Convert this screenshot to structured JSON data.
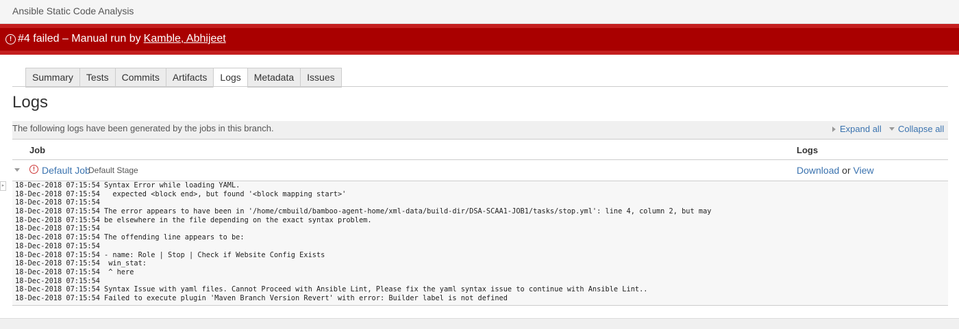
{
  "plan": {
    "name": "Ansible Static Code Analysis"
  },
  "banner": {
    "icon": "alert-circle-icon",
    "status_text": "#4 failed – Manual run by",
    "user": "Kamble, Abhijeet",
    "color": "#a90000"
  },
  "tabs": [
    {
      "label": "Summary",
      "active": false
    },
    {
      "label": "Tests",
      "active": false
    },
    {
      "label": "Commits",
      "active": false
    },
    {
      "label": "Artifacts",
      "active": false
    },
    {
      "label": "Logs",
      "active": true
    },
    {
      "label": "Metadata",
      "active": false
    },
    {
      "label": "Issues",
      "active": false
    }
  ],
  "page": {
    "title": "Logs",
    "intro": "The following logs have been generated by the jobs in this branch.",
    "expand_all": "Expand all",
    "collapse_all": "Collapse all"
  },
  "table": {
    "col_job": "Job",
    "col_logs": "Logs"
  },
  "job": {
    "name": "Default Job",
    "stage": "Default Stage",
    "download": "Download",
    "or": "or",
    "view": "View"
  },
  "log_lines": [
    {
      "ts": "18-Dec-2018 07:15:54",
      "msg": "Syntax Error while loading YAML."
    },
    {
      "ts": "18-Dec-2018 07:15:54",
      "msg": "  expected <block end>, but found '<block mapping start>'"
    },
    {
      "ts": "18-Dec-2018 07:15:54",
      "msg": ""
    },
    {
      "ts": "18-Dec-2018 07:15:54",
      "msg": "The error appears to have been in '/home/cmbuild/bamboo-agent-home/xml-data/build-dir/DSA-SCAA1-JOB1/tasks/stop.yml': line 4, column 2, but may"
    },
    {
      "ts": "18-Dec-2018 07:15:54",
      "msg": "be elsewhere in the file depending on the exact syntax problem."
    },
    {
      "ts": "18-Dec-2018 07:15:54",
      "msg": ""
    },
    {
      "ts": "18-Dec-2018 07:15:54",
      "msg": "The offending line appears to be:"
    },
    {
      "ts": "18-Dec-2018 07:15:54",
      "msg": ""
    },
    {
      "ts": "18-Dec-2018 07:15:54",
      "msg": "- name: Role | Stop | Check if Website Config Exists"
    },
    {
      "ts": "18-Dec-2018 07:15:54",
      "msg": " win_stat:"
    },
    {
      "ts": "18-Dec-2018 07:15:54",
      "msg": " ^ here"
    },
    {
      "ts": "18-Dec-2018 07:15:54",
      "msg": ""
    },
    {
      "ts": "18-Dec-2018 07:15:54",
      "msg": "Syntax Issue with yaml files. Cannot Proceed with Ansible Lint, Please fix the yaml syntax issue to continue with Ansible Lint.."
    },
    {
      "ts": "18-Dec-2018 07:15:54",
      "msg": "Failed to execute plugin 'Maven Branch Version Revert' with error: Builder label is not defined"
    }
  ]
}
